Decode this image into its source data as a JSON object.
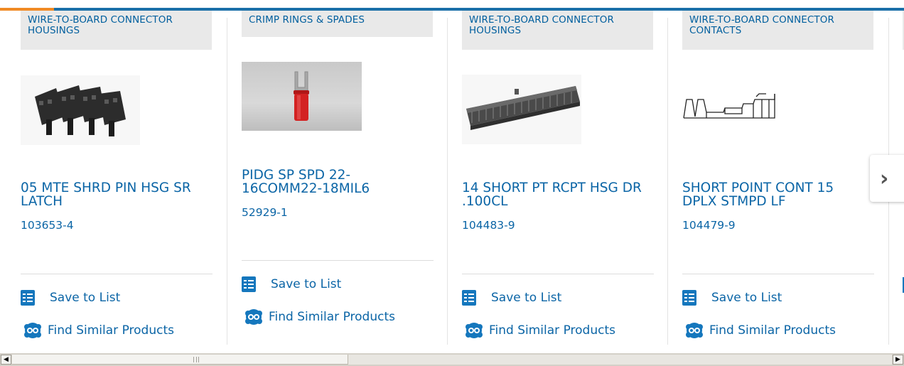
{
  "products": [
    {
      "category": "WIRE-TO-BOARD CONNECTOR HOUSINGS",
      "name": "05 MTE SHRD PIN HSG SR LATCH",
      "part_number": "103653-4",
      "save_label": "Save to List",
      "similar_label": "Find Similar Products"
    },
    {
      "category": "CRIMP RINGS & SPADES",
      "name": "PIDG SP SPD 22-16COMM22-18MIL6",
      "part_number": "52929-1",
      "save_label": "Save to List",
      "similar_label": "Find Similar Products"
    },
    {
      "category": "WIRE-TO-BOARD CONNECTOR HOUSINGS",
      "name": "14 SHORT PT RCPT HSG DR .100CL",
      "part_number": "104483-9",
      "save_label": "Save to List",
      "similar_label": "Find Similar Products"
    },
    {
      "category": "WIRE-TO-BOARD CONNECTOR CONTACTS",
      "name": "SHORT POINT CONT 15 DPLX STMPD LF",
      "part_number": "104479-9",
      "save_label": "Save to List",
      "similar_label": "Find Similar Products"
    }
  ],
  "carousel": {
    "next_icon": "chevron-right-icon",
    "next_glyph": "›"
  },
  "scrollbar": {
    "left_glyph": "◀",
    "right_glyph": "▶"
  },
  "colors": {
    "accent": "#f08a24",
    "brand": "#1a6fa8",
    "link": "#0b65a6"
  }
}
